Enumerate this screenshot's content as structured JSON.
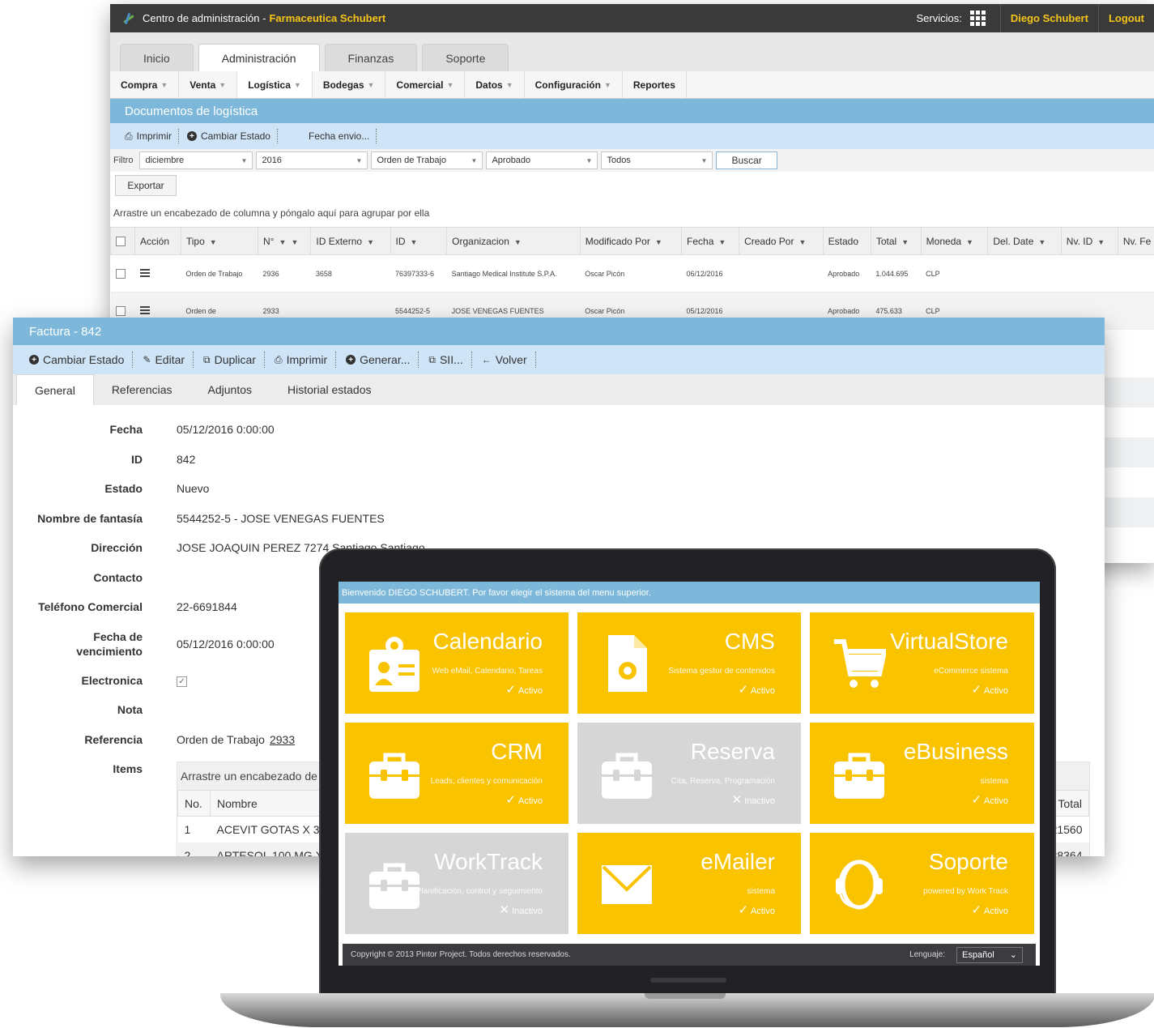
{
  "window1": {
    "app_title": "Centro de administración - ",
    "company": "Farmaceutica Schubert",
    "servicios_label": "Servicios:",
    "user": "Diego Schubert",
    "logout": "Logout",
    "tabs": [
      "Inicio",
      "Administración",
      "Finanzas",
      "Soporte"
    ],
    "menu": [
      "Compra",
      "Venta",
      "Logística",
      "Bodegas",
      "Comercial",
      "Datos",
      "Configuración",
      "Reportes"
    ],
    "section_title": "Documentos de logística",
    "toolbar": {
      "print": "Imprimir",
      "change_state": "Cambiar Estado",
      "send_date": "Fecha envio..."
    },
    "filter": {
      "label": "Filtro",
      "month": "diciembre",
      "year": "2016",
      "doc_type": "Orden de Trabajo",
      "state": "Aprobado",
      "scope": "Todos",
      "search": "Buscar"
    },
    "export": "Exportar",
    "group_hint": "Arrastre un encabezado de columna y póngalo aquí para agrupar por ella",
    "columns": [
      "Acción",
      "Tipo",
      "N°",
      "ID Externo",
      "ID",
      "Organizacion",
      "Modificado Por",
      "Fecha",
      "Creado Por",
      "Estado",
      "Total",
      "Moneda",
      "Del. Date",
      "Nv. ID",
      "Nv. Fe"
    ],
    "rows": [
      {
        "tipo": "Orden de Trabajo",
        "numero": "2936",
        "id_externo": "3658",
        "id": "76397333-6",
        "organizacion": "Santiago Medical Institute S.P.A.",
        "modificado_por": "Oscar Picón",
        "fecha": "06/12/2016",
        "estado": "Aprobado",
        "total": "1.044.695",
        "moneda": "CLP"
      },
      {
        "tipo": "Orden de",
        "numero": "2933",
        "id_externo": "",
        "id": "5544252-5",
        "organizacion": "JOSE VENEGAS FUENTES",
        "modificado_por": "Oscar Picón",
        "fecha": "05/12/2016",
        "estado": "Aprobado",
        "total": "475.633",
        "moneda": "CLP"
      }
    ]
  },
  "window2": {
    "title": "Factura - 842",
    "toolbar": [
      "Cambiar Estado",
      "Editar",
      "Duplicar",
      "Imprimir",
      "Generar...",
      "SII...",
      "Volver"
    ],
    "tabs": [
      "General",
      "Referencias",
      "Adjuntos",
      "Historial estados"
    ],
    "fields": {
      "fecha_label": "Fecha",
      "fecha": "05/12/2016 0:00:00",
      "id_label": "ID",
      "id": "842",
      "estado_label": "Estado",
      "estado": "Nuevo",
      "fantasia_label": "Nombre de fantasía",
      "fantasia": "5544252-5 - JOSE VENEGAS FUENTES",
      "direccion_label": "Dirección",
      "direccion": "JOSE JOAQUIN PEREZ 7274 Santiago Santiago",
      "contacto_label": "Contacto",
      "contacto": "",
      "telefono_label": "Teléfono Comercial",
      "telefono": "22-6691844",
      "vencimiento_label_1": "Fecha de",
      "vencimiento_label_2": "vencimiento",
      "vencimiento": "05/12/2016 0:00:00",
      "electronica_label": "Electronica",
      "electronica_checked": true,
      "electronica_mark": "✓",
      "nota_label": "Nota",
      "nota": "",
      "referencia_label": "Referencia",
      "referencia_text": "Orden de Trabajo",
      "referencia_link": "2933",
      "items_label": "Items"
    },
    "items": {
      "group_hint": "Arrastre un encabezado de c",
      "col_no": "No.",
      "col_nombre": "Nombre",
      "col_total": "Total",
      "rows": [
        {
          "no": "1",
          "nombre": "ACEVIT GOTAS X 30",
          "total": "21560"
        },
        {
          "no": "2",
          "nombre": "ARTESOL 100 MG X",
          "total": "38364"
        }
      ]
    }
  },
  "laptop": {
    "welcome": "Bienvenido DIEGO SCHUBERT. Por favor elegir el sistema del menu superior.",
    "tiles": [
      {
        "name": "Calendario",
        "desc": "Web eMail, Calendario, Tareas",
        "status": "Activo",
        "active": true,
        "icon": "id-card-icon"
      },
      {
        "name": "CMS",
        "desc": "Sistema gestor de contenidos",
        "status": "Activo",
        "active": true,
        "icon": "document-gear-icon"
      },
      {
        "name": "VirtualStore",
        "desc": "eCommerce sistema",
        "status": "Activo",
        "active": true,
        "icon": "shopping-cart-icon"
      },
      {
        "name": "CRM",
        "desc": "Leads, clientes y comunicación",
        "status": "Activo",
        "active": true,
        "icon": "briefcase-icon"
      },
      {
        "name": "Reserva",
        "desc": "Cita, Reserva, Programación",
        "status": "Inactivo",
        "active": false,
        "icon": "briefcase-icon"
      },
      {
        "name": "eBusiness",
        "desc": "sistema",
        "status": "Activo",
        "active": true,
        "icon": "briefcase-icon"
      },
      {
        "name": "WorkTrack",
        "desc": "Planificación, control y seguimiento",
        "status": "Inactivo",
        "active": false,
        "icon": "briefcase-icon"
      },
      {
        "name": "eMailer",
        "desc": "sistema",
        "status": "Activo",
        "active": true,
        "icon": "envelope-icon"
      },
      {
        "name": "Soporte",
        "desc": "powered by Work Track",
        "status": "Activo",
        "active": true,
        "icon": "headset-icon"
      }
    ],
    "active_mark": "✓",
    "inactive_mark": "✕",
    "copyright": "Copyright © 2013 Pintor Project. Todos derechos reservados.",
    "language_label": "Lenguaje:",
    "language": "Español"
  },
  "colors": {
    "accent_blue": "#7db8da",
    "toolbar_blue": "#cfe4f7",
    "tile_yellow": "#f9c300",
    "tile_gray": "#d6d6d6",
    "brand_gold": "#f5c518"
  }
}
